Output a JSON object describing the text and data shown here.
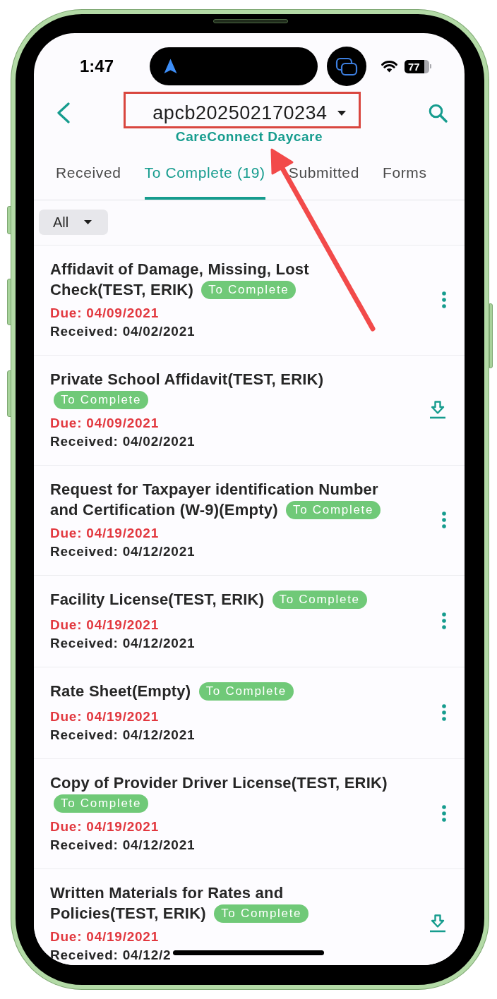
{
  "status_bar": {
    "time": "1:47",
    "battery": "77"
  },
  "header": {
    "title": "apcb202502170234",
    "subtitle": "CareConnect Daycare"
  },
  "tabs": [
    {
      "label": "Received",
      "selected": false
    },
    {
      "label": "To Complete (19)",
      "selected": true
    },
    {
      "label": "Submitted",
      "selected": false
    },
    {
      "label": "Forms",
      "selected": false
    }
  ],
  "filter": {
    "value": "All"
  },
  "documents": [
    {
      "title": "Affidavit of Damage, Missing, Lost Check(TEST, ERIK)",
      "status": "To Complete",
      "due": "Due: 04/09/2021",
      "received": "Received: 04/02/2021",
      "kind": "menu"
    },
    {
      "title": "Private School Affidavit(TEST, ERIK)",
      "status": "To Complete",
      "due": "Due: 04/09/2021",
      "received": "Received: 04/02/2021",
      "kind": "download"
    },
    {
      "title": "Request for Taxpayer identification Number and Certification (W-9)(Empty)",
      "status": "To Complete",
      "due": "Due: 04/19/2021",
      "received": "Received: 04/12/2021",
      "kind": "menu"
    },
    {
      "title": "Facility License(TEST, ERIK)",
      "status": "To Complete",
      "due": "Due: 04/19/2021",
      "received": "Received: 04/12/2021",
      "kind": "menu"
    },
    {
      "title": "Rate Sheet(Empty)",
      "status": "To Complete",
      "due": "Due: 04/19/2021",
      "received": "Received: 04/12/2021",
      "kind": "menu"
    },
    {
      "title": "Copy of Provider Driver License(TEST, ERIK)",
      "status": "To Complete",
      "due": "Due: 04/19/2021",
      "received": "Received: 04/12/2021",
      "kind": "menu"
    },
    {
      "title": "Written Materials for Rates and Policies(TEST, ERIK)",
      "status": "To Complete",
      "due": "Due: 04/19/2021",
      "received": "Received: 04/12/2",
      "kind": "download"
    }
  ]
}
